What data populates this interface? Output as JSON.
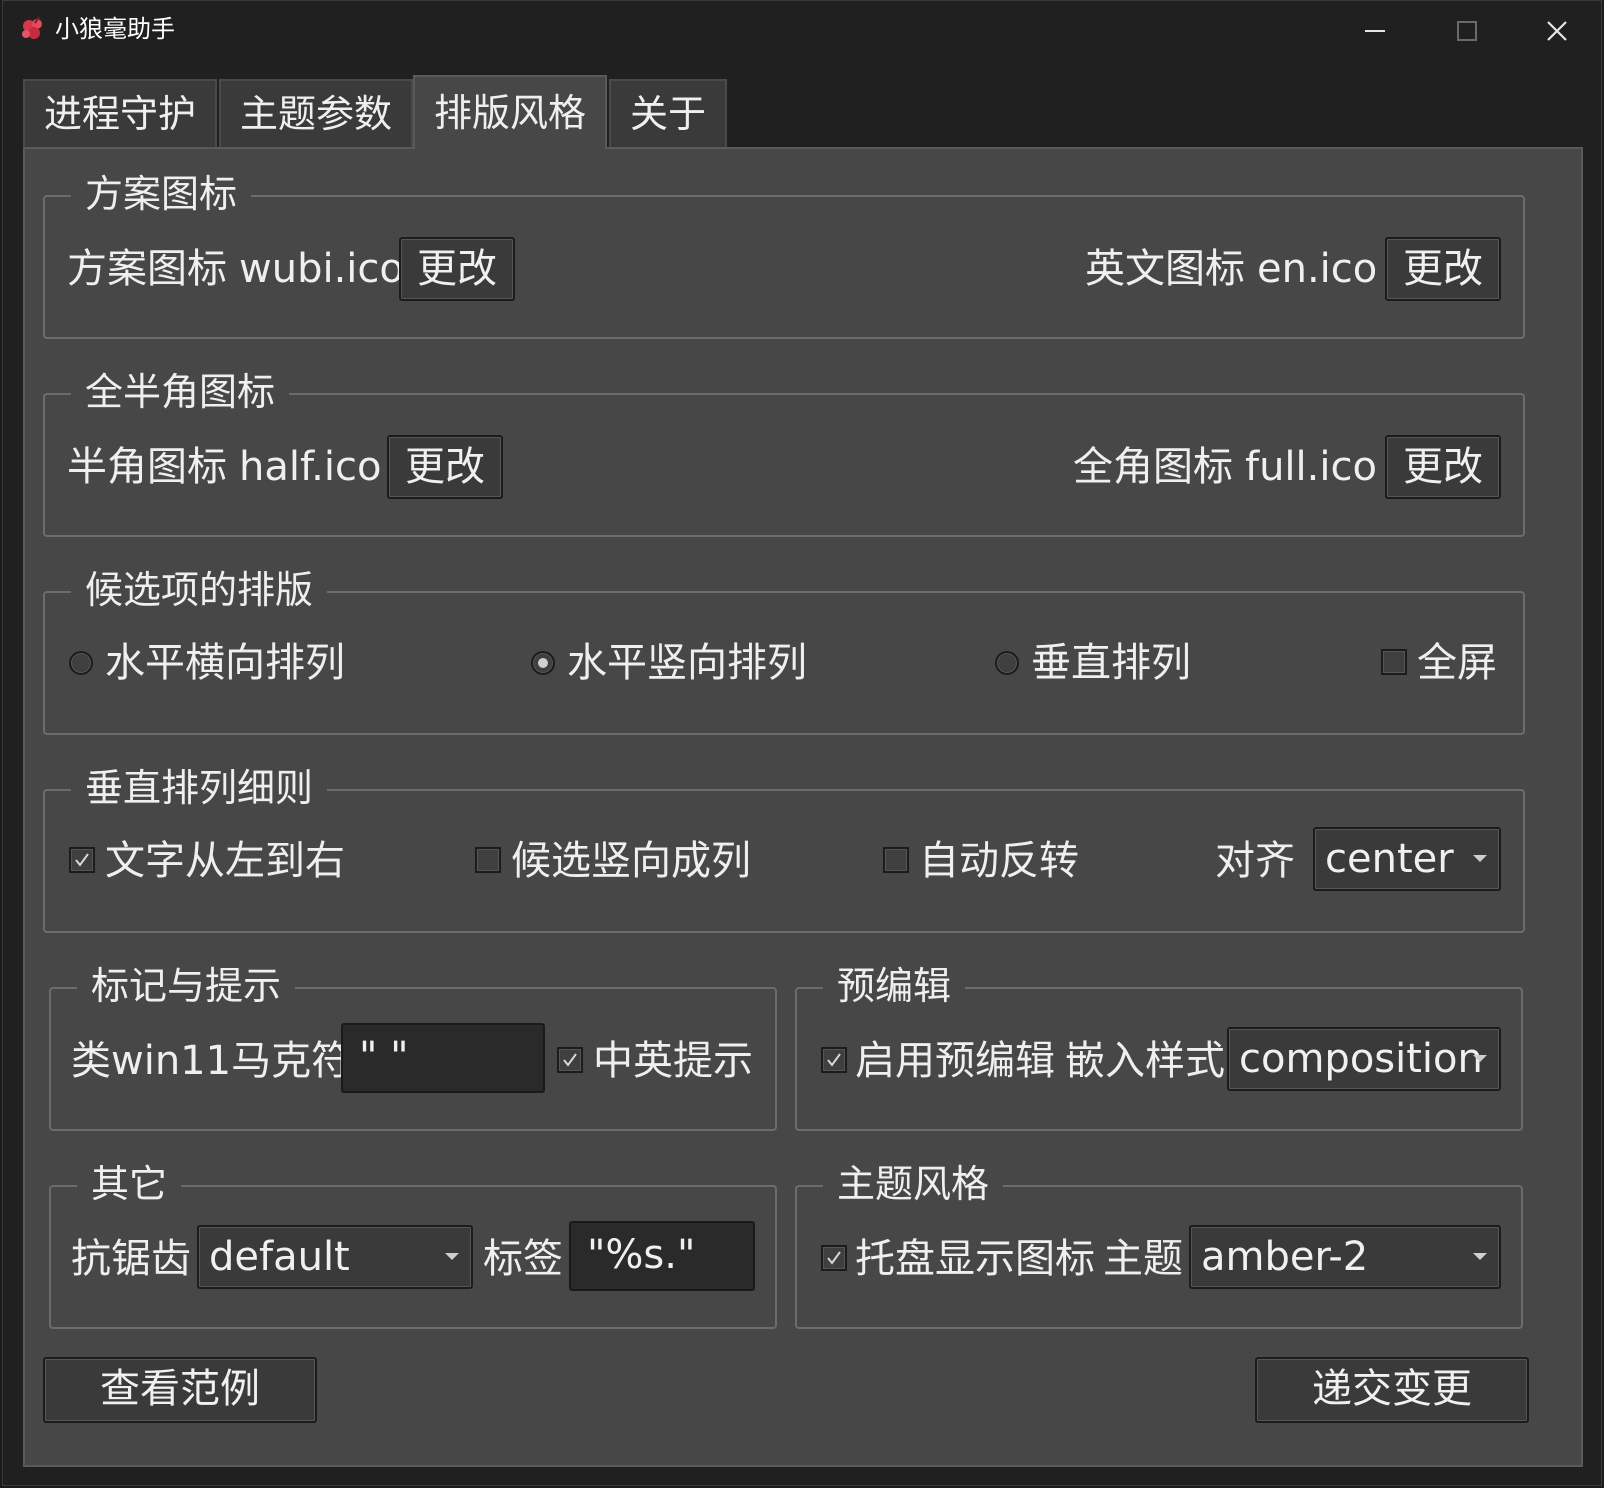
{
  "window": {
    "title": "小狼毫助手",
    "controls": {
      "minimize": "minimize",
      "maximize": "maximize",
      "close": "close"
    }
  },
  "tabs": [
    {
      "label": "进程守护",
      "active": false
    },
    {
      "label": "主题参数",
      "active": false
    },
    {
      "label": "排版风格",
      "active": true
    },
    {
      "label": "关于",
      "active": false
    }
  ],
  "scheme_icon": {
    "legend": "方案图标",
    "scheme_label": "方案图标",
    "scheme_file": "wubi.ico",
    "scheme_button": "更改",
    "english_label": "英文图标",
    "english_file": "en.ico",
    "english_button": "更改"
  },
  "width_icon": {
    "legend": "全半角图标",
    "half_label": "半角图标",
    "half_file": "half.ico",
    "half_button": "更改",
    "full_label": "全角图标",
    "full_file": "full.ico",
    "full_button": "更改"
  },
  "layout": {
    "legend": "候选项的排版",
    "options": [
      {
        "label": "水平横向排列",
        "selected": false
      },
      {
        "label": "水平竖向排列",
        "selected": true
      },
      {
        "label": "垂直排列",
        "selected": false
      }
    ],
    "fullscreen": {
      "label": "全屏",
      "checked": false
    }
  },
  "vertical_rules": {
    "legend": "垂直排列细则",
    "text_ltr": {
      "label": "文字从左到右",
      "checked": true
    },
    "candidate_column": {
      "label": "候选竖向成列",
      "checked": false
    },
    "auto_reverse": {
      "label": "自动反转",
      "checked": false
    },
    "align_label": "对齐",
    "align_value": "center"
  },
  "marks": {
    "legend": "标记与提示",
    "win11_label": "类win11马克符",
    "win11_value": "\" \"",
    "cn_en_hint": {
      "label": "中英提示",
      "checked": true
    }
  },
  "preedit": {
    "legend": "预编辑",
    "enable": {
      "label": "启用预编辑",
      "checked": true
    },
    "embed_label": "嵌入样式",
    "embed_value": "composition"
  },
  "other": {
    "legend": "其它",
    "antialias_label": "抗锯齿",
    "antialias_value": "default",
    "tag_label": "标签",
    "tag_value": "\"%s.\""
  },
  "theme_style": {
    "legend": "主题风格",
    "tray_icon": {
      "label": "托盘显示图标",
      "checked": true
    },
    "theme_label": "主题",
    "theme_value": "amber-2"
  },
  "footer": {
    "preview_button": "查看范例",
    "submit_button": "递交变更"
  },
  "colors": {
    "window_bg": "#202020",
    "panel_bg": "#474747",
    "text": "#ececec",
    "icon_red": "#d8374a"
  }
}
